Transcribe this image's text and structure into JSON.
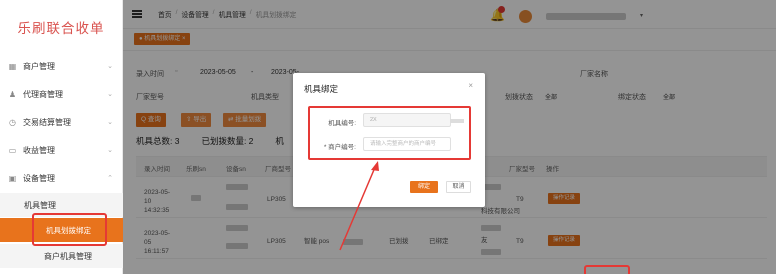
{
  "app": {
    "title": "乐刷联合收单"
  },
  "sidebar": {
    "items": [
      {
        "label": "商户管理",
        "icon": "grid-icon"
      },
      {
        "label": "代理商管理",
        "icon": "user-icon"
      },
      {
        "label": "交易结算管理",
        "icon": "clock-icon"
      },
      {
        "label": "收益管理",
        "icon": "wallet-icon"
      },
      {
        "label": "设备管理",
        "icon": "device-icon"
      }
    ],
    "sub_items": [
      {
        "label": "机具管理"
      },
      {
        "label": "机具划拨绑定"
      },
      {
        "label": "商户机具管理"
      }
    ]
  },
  "topbar": {
    "breadcrumb": [
      "首页",
      "设备管理",
      "机具管理",
      "机具划拨绑定"
    ]
  },
  "tabbar": {
    "active_tab": "● 机具划拨绑定 ×"
  },
  "filters": {
    "entry_time_label": "录入时间",
    "date_start": "2023-05-05",
    "date_sep": "-",
    "date_end": "2023-05-",
    "vendor_name_label": "厂家名称",
    "vendor_model_label": "厂家型号",
    "machine_type_label": "机具类型",
    "transfer_status_label": "划拨状态",
    "transfer_status_value": "全部",
    "bind_status_label": "绑定状态",
    "bind_status_value": "全部"
  },
  "toolbar": {
    "query_label": "Q 查询",
    "export_label": "⇧ 导出",
    "batch_label": "⇄ 批量划拨"
  },
  "stats": {
    "total_label": "机具总数: 3",
    "transferred_label": "已划拨数量: 2",
    "bound_label": "机"
  },
  "table": {
    "headers": [
      "录入时间",
      "乐刷sn",
      "设备sn",
      "厂商型号",
      "",
      "厂家型号",
      "操作"
    ],
    "rows": [
      {
        "time": "2023-05-10 14:32:35",
        "model": "LP305",
        "vendor_text": "科技有限公司",
        "vendor_model": "T9",
        "action": "操作记录"
      },
      {
        "time": "2023-05-05 16:11:57",
        "model": "LP305",
        "type": "智能 pos",
        "status_a": "已划拨",
        "status_b": "已绑定",
        "vendor_text": "友",
        "vendor_model": "T9",
        "action": "操作记录"
      }
    ]
  },
  "modal": {
    "title": "机具绑定",
    "close": "×",
    "machine_label": "机具编号:",
    "machine_value": "2X",
    "merchant_label": "* 商户编号:",
    "merchant_placeholder": "请输入完整商户的商户编号",
    "confirm_label": "绑定",
    "cancel_label": "取消"
  },
  "colors": {
    "accent": "#e8731c",
    "annotation": "#e53935",
    "logo": "#d9534f"
  }
}
